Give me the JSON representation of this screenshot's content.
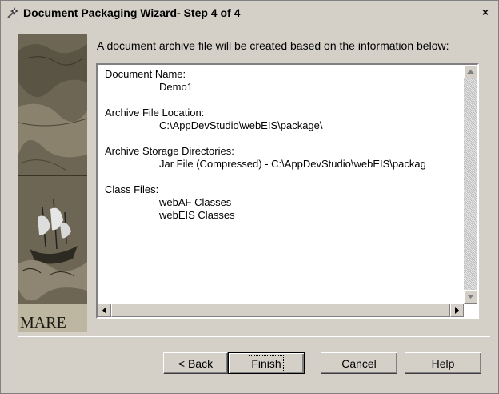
{
  "window": {
    "title": "Document Packaging Wizard- Step 4 of 4",
    "close_glyph": "×",
    "icon": "wizard-icon"
  },
  "main": {
    "intro": "A document archive file will be created based on the information below:",
    "sections": [
      {
        "label": "Document Name:",
        "values": [
          "Demo1"
        ]
      },
      {
        "label": "Archive File Location:",
        "values": [
          "C:\\AppDevStudio\\webEIS\\package\\"
        ]
      },
      {
        "label": "Archive Storage Directories:",
        "values": [
          "Jar File (Compressed) - C:\\AppDevStudio\\webEIS\\packag"
        ]
      },
      {
        "label": "Class Files:",
        "values": [
          "webAF Classes",
          "webEIS Classes"
        ]
      }
    ],
    "art_text": "MARE"
  },
  "buttons": {
    "back": "< Back",
    "finish": "Finish",
    "cancel": "Cancel",
    "help": "Help"
  }
}
